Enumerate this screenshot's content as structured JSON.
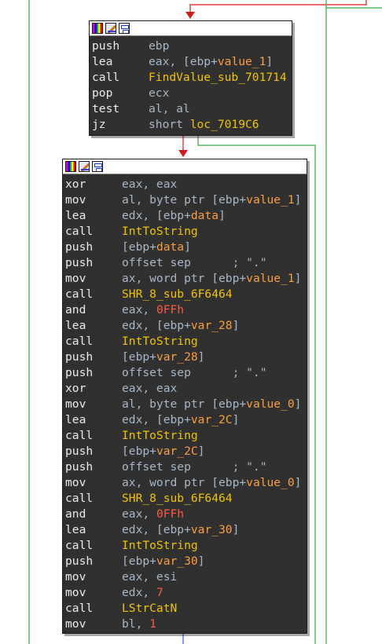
{
  "block_top": {
    "titlebar_icons": [
      "palette-icon",
      "edit-icon",
      "graph-icon"
    ],
    "lines": [
      {
        "mnemonic": "push",
        "operand": [
          {
            "t": "ebp",
            "c": "reg"
          }
        ]
      },
      {
        "mnemonic": "lea",
        "operand": [
          {
            "t": "eax, [ebp+",
            "c": "reg"
          },
          {
            "t": "value_1",
            "c": "var"
          },
          {
            "t": "]",
            "c": "reg"
          }
        ]
      },
      {
        "mnemonic": "call",
        "operand": [
          {
            "t": "FindValue_sub_701714",
            "c": "sym"
          }
        ]
      },
      {
        "mnemonic": "pop",
        "operand": [
          {
            "t": "ecx",
            "c": "reg"
          }
        ]
      },
      {
        "mnemonic": "test",
        "operand": [
          {
            "t": "al, al",
            "c": "reg"
          }
        ]
      },
      {
        "mnemonic": "jz",
        "operand": [
          {
            "t": "short ",
            "c": "reg"
          },
          {
            "t": "loc_7019C6",
            "c": "sym"
          }
        ]
      }
    ]
  },
  "block_main": {
    "titlebar_icons": [
      "palette-icon",
      "edit-icon",
      "graph-icon"
    ],
    "lines": [
      {
        "mnemonic": "xor",
        "operand": [
          {
            "t": "eax, eax",
            "c": "reg"
          }
        ]
      },
      {
        "mnemonic": "mov",
        "operand": [
          {
            "t": "al, byte ptr [ebp+",
            "c": "reg"
          },
          {
            "t": "value_1",
            "c": "var"
          },
          {
            "t": "]",
            "c": "reg"
          }
        ]
      },
      {
        "mnemonic": "lea",
        "operand": [
          {
            "t": "edx, [ebp+",
            "c": "reg"
          },
          {
            "t": "data",
            "c": "var"
          },
          {
            "t": "]",
            "c": "reg"
          }
        ]
      },
      {
        "mnemonic": "call",
        "operand": [
          {
            "t": "IntToString",
            "c": "sym"
          }
        ]
      },
      {
        "mnemonic": "push",
        "operand": [
          {
            "t": "[ebp+",
            "c": "reg"
          },
          {
            "t": "data",
            "c": "var"
          },
          {
            "t": "]",
            "c": "reg"
          }
        ]
      },
      {
        "mnemonic": "push",
        "operand": [
          {
            "t": "offset sep      ; \".\"",
            "c": "reg"
          }
        ]
      },
      {
        "mnemonic": "mov",
        "operand": [
          {
            "t": "ax, word ptr [ebp+",
            "c": "reg"
          },
          {
            "t": "value_1",
            "c": "var"
          },
          {
            "t": "]",
            "c": "reg"
          }
        ]
      },
      {
        "mnemonic": "call",
        "operand": [
          {
            "t": "SHR_8_sub_6F6464",
            "c": "sym"
          }
        ]
      },
      {
        "mnemonic": "and",
        "operand": [
          {
            "t": "eax, ",
            "c": "reg"
          },
          {
            "t": "0FFh",
            "c": "num"
          }
        ]
      },
      {
        "mnemonic": "lea",
        "operand": [
          {
            "t": "edx, [ebp+",
            "c": "reg"
          },
          {
            "t": "var_28",
            "c": "var"
          },
          {
            "t": "]",
            "c": "reg"
          }
        ]
      },
      {
        "mnemonic": "call",
        "operand": [
          {
            "t": "IntToString",
            "c": "sym"
          }
        ]
      },
      {
        "mnemonic": "push",
        "operand": [
          {
            "t": "[ebp+",
            "c": "reg"
          },
          {
            "t": "var_28",
            "c": "var"
          },
          {
            "t": "]",
            "c": "reg"
          }
        ]
      },
      {
        "mnemonic": "push",
        "operand": [
          {
            "t": "offset sep      ; \".\"",
            "c": "reg"
          }
        ]
      },
      {
        "mnemonic": "xor",
        "operand": [
          {
            "t": "eax, eax",
            "c": "reg"
          }
        ]
      },
      {
        "mnemonic": "mov",
        "operand": [
          {
            "t": "al, byte ptr [ebp+",
            "c": "reg"
          },
          {
            "t": "value_0",
            "c": "var"
          },
          {
            "t": "]",
            "c": "reg"
          }
        ]
      },
      {
        "mnemonic": "lea",
        "operand": [
          {
            "t": "edx, [ebp+",
            "c": "reg"
          },
          {
            "t": "var_2C",
            "c": "var"
          },
          {
            "t": "]",
            "c": "reg"
          }
        ]
      },
      {
        "mnemonic": "call",
        "operand": [
          {
            "t": "IntToString",
            "c": "sym"
          }
        ]
      },
      {
        "mnemonic": "push",
        "operand": [
          {
            "t": "[ebp+",
            "c": "reg"
          },
          {
            "t": "var_2C",
            "c": "var"
          },
          {
            "t": "]",
            "c": "reg"
          }
        ]
      },
      {
        "mnemonic": "push",
        "operand": [
          {
            "t": "offset sep      ; \".\"",
            "c": "reg"
          }
        ]
      },
      {
        "mnemonic": "mov",
        "operand": [
          {
            "t": "ax, word ptr [ebp+",
            "c": "reg"
          },
          {
            "t": "value_0",
            "c": "var"
          },
          {
            "t": "]",
            "c": "reg"
          }
        ]
      },
      {
        "mnemonic": "call",
        "operand": [
          {
            "t": "SHR_8_sub_6F6464",
            "c": "sym"
          }
        ]
      },
      {
        "mnemonic": "and",
        "operand": [
          {
            "t": "eax, ",
            "c": "reg"
          },
          {
            "t": "0FFh",
            "c": "num"
          }
        ]
      },
      {
        "mnemonic": "lea",
        "operand": [
          {
            "t": "edx, [ebp+",
            "c": "reg"
          },
          {
            "t": "var_30",
            "c": "var"
          },
          {
            "t": "]",
            "c": "reg"
          }
        ]
      },
      {
        "mnemonic": "call",
        "operand": [
          {
            "t": "IntToString",
            "c": "sym"
          }
        ]
      },
      {
        "mnemonic": "push",
        "operand": [
          {
            "t": "[ebp+",
            "c": "reg"
          },
          {
            "t": "var_30",
            "c": "var"
          },
          {
            "t": "]",
            "c": "reg"
          }
        ]
      },
      {
        "mnemonic": "mov",
        "operand": [
          {
            "t": "eax, esi",
            "c": "reg"
          }
        ]
      },
      {
        "mnemonic": "mov",
        "operand": [
          {
            "t": "edx, ",
            "c": "reg"
          },
          {
            "t": "7",
            "c": "num"
          }
        ]
      },
      {
        "mnemonic": "call",
        "operand": [
          {
            "t": "LStrCatN",
            "c": "sym"
          }
        ]
      },
      {
        "mnemonic": "mov",
        "operand": [
          {
            "t": "bl, ",
            "c": "reg"
          },
          {
            "t": "1",
            "c": "num"
          }
        ]
      }
    ]
  },
  "colors": {
    "edge_true": "#3aa64a",
    "edge_false": "#d21c1c",
    "edge_normal": "#3050ff",
    "block_bg": "#303030",
    "mnemonic": "#ececec",
    "register": "#a8b8c8",
    "variable": "#ff9e3d",
    "symbol": "#f2c400",
    "number": "#ff5a3d"
  }
}
